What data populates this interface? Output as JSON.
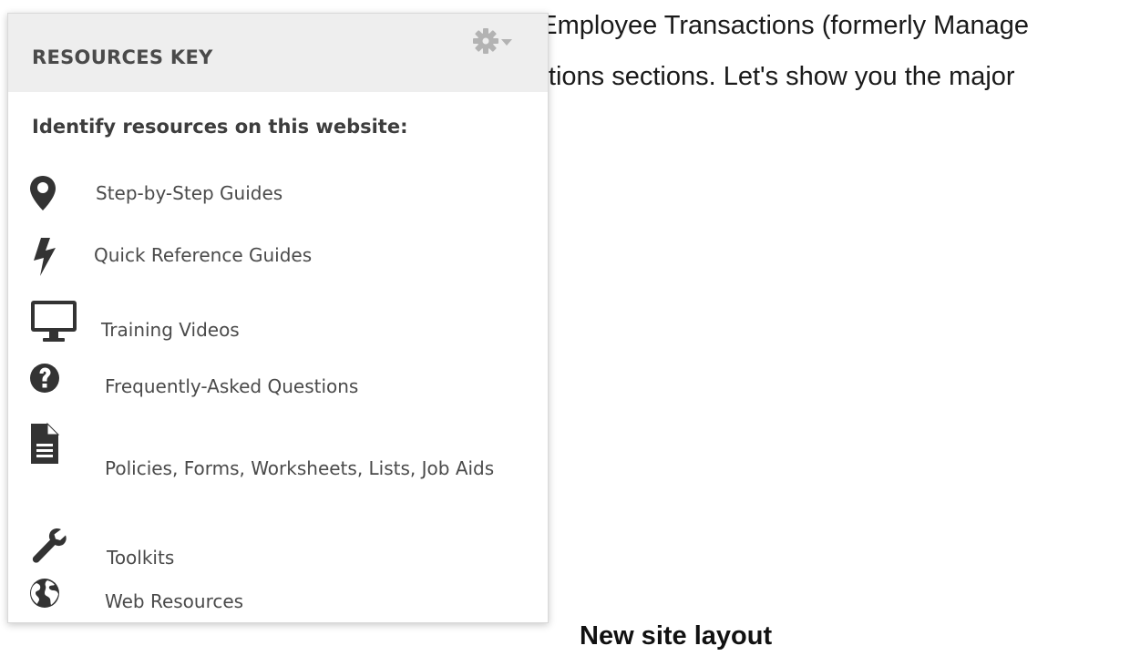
{
  "background": {
    "line1": "e, Employee Transactions (formerly Manage",
    "line2": "arations sections. Let's show you the major",
    "heading": "New site layout"
  },
  "panel": {
    "title": "RESOURCES KEY",
    "settings_icon": "gear-icon",
    "intro": "Identify resources on this website:",
    "items": [
      {
        "label": "Step-by-Step Guides",
        "icon": "map-marker-icon"
      },
      {
        "label": "Quick Reference Guides",
        "icon": "lightning-bolt-icon"
      },
      {
        "label": "Training Videos",
        "icon": "monitor-icon"
      },
      {
        "label": "Frequently-Asked Questions",
        "icon": "question-circle-icon"
      },
      {
        "label": "Policies, Forms, Worksheets, Lists, Job Aids",
        "icon": "document-icon"
      },
      {
        "label": "Toolkits",
        "icon": "wrench-icon"
      },
      {
        "label": "Web Resources",
        "icon": "globe-icon"
      }
    ]
  },
  "colors": {
    "header_bg": "#eeeeee",
    "icon": "#333333",
    "text": "#4a4a4a"
  }
}
